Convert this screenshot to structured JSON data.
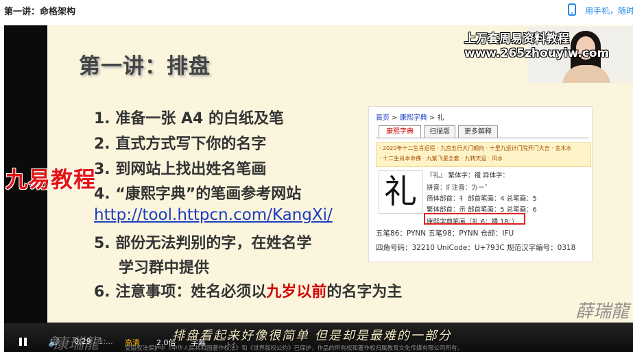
{
  "page": {
    "title": "第一讲：命格架构",
    "phone_link": "用手机，随时"
  },
  "slide": {
    "title": "第一讲：排盘",
    "items": [
      "1. 准备一张 A4 的白纸及笔",
      "2. 直式方式写下你的名字",
      "3. 到网站上找出姓名笔画",
      "4. “康熙字典”的笔画参考网站"
    ],
    "url": "http://tool.httpcn.com/KangXi/",
    "item5_line1": "5. 部份无法判别的字，在姓名学",
    "item5_line2": "学习群中提供",
    "item6_prefix": "6. 注意事项：姓名必须以",
    "item6_highlight": "九岁以前",
    "item6_suffix": "的名字为主"
  },
  "dict": {
    "crumb_home": "首页",
    "crumb_section": "康熙字典",
    "crumb_char": "礼",
    "tabs": [
      "康熙字典",
      "扫描版",
      "更多解释"
    ],
    "links_row1": "· 2020年十二生肖运程 · 九宫五行大门朝向 · 十里九运计门院开门大吉 · 金木水",
    "links_row2": "· 十二生肖本命佛 · 九紫飞星全套 · 九转天运 · 风水",
    "char": "礼",
    "row1": "『礼』  繁体字：禮    异体字：",
    "row2": "拼音：lǐ      注音：ㄌㄧˇ",
    "row3": "简体部首：礻  部首笔画：4  总笔画：5",
    "row4": "繁体部首：示  部首笔画：5  总笔画：6",
    "row5": "康熙字典笔画（礼 6；禮 18；）",
    "row6": "五笔86：PYNN   五笔98：PYNN   仓颉：IFU",
    "row7": "四角号码：32210   UniCode：U+793C   规范汉字编号：0318"
  },
  "brand": "九易教程",
  "watermark_line1": "上万套周易资料教程",
  "watermark_line2": "www.265zhouyiw.com",
  "seal": "薛瑞龍",
  "player": {
    "current_time": "0:29",
    "total_time": "/ 1:...",
    "quality": "高清",
    "speed": "2.0倍",
    "subtitles": "字幕",
    "caption": "排盘看起来好像很简单 但是却是最难的一部分",
    "copyright": "受版权法保护中《中华人民共和国著作权法》和《世界版权公约》已保护，作品的所有权和著作权归属教育文化传媒有限公司所有。",
    "watermark_logo": "康瑞龍"
  }
}
